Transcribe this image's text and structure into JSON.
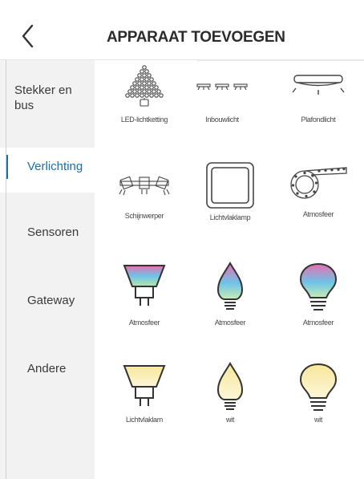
{
  "header": {
    "title": "APPARAAT TOEVOEGEN",
    "back_icon": "chevron-left-icon"
  },
  "sidebar": {
    "items": [
      {
        "label": "Stekker en bus"
      },
      {
        "label": "Verlichting"
      },
      {
        "label": "Sensoren"
      },
      {
        "label": "Gateway"
      },
      {
        "label": "Andere"
      }
    ],
    "active_color": "#1a6fb0"
  },
  "devices": [
    {
      "label": "LED-lichtketting",
      "icon": "led-string-tree-icon"
    },
    {
      "label": "Inbouwlicht",
      "icon": "recessed-lights-icon"
    },
    {
      "label": "Plafondlicht",
      "icon": "ceiling-light-icon"
    },
    {
      "label": "Schijnwerper",
      "icon": "spotlight-bar-icon"
    },
    {
      "label": "Lichtvlaklamp",
      "icon": "light-panel-icon"
    },
    {
      "label": "Atmosfeer",
      "icon": "light-strip-reel-icon"
    },
    {
      "label": "Atmosfeer",
      "icon": "gu10-color-bulb-icon"
    },
    {
      "label": "Atmosfeer",
      "icon": "candle-color-bulb-icon"
    },
    {
      "label": "Atmosfeer",
      "icon": "a-shape-color-bulb-icon"
    },
    {
      "label": "Lichtvlaklam",
      "icon": "gu10-white-bulb-icon"
    },
    {
      "label": "wit",
      "icon": "candle-white-bulb-icon"
    },
    {
      "label": "wit",
      "icon": "a-shape-white-bulb-icon"
    }
  ]
}
